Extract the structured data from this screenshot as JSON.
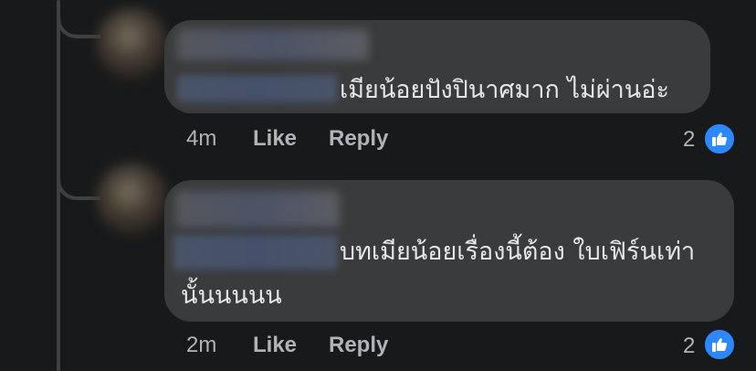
{
  "comments": [
    {
      "text_line1": "เมียน้อยปังปินาศมาก ไม่ผ่านอ่ะ",
      "time": "4m",
      "like_label": "Like",
      "reply_label": "Reply",
      "reaction_count": "2",
      "reaction_icon": "thumbs-up-icon"
    },
    {
      "text_line1": "บทเมียน้อยเรื่องนี้ต้อง ใบเฟิร์นเท่า",
      "text_line2": "นั้นนนนน",
      "time": "2m",
      "like_label": "Like",
      "reply_label": "Reply",
      "reaction_count": "2",
      "reaction_icon": "thumbs-up-icon"
    }
  ],
  "colors": {
    "background": "#18191a",
    "bubble": "#3a3b3c",
    "text": "#e4e6eb",
    "meta": "#b0b3b8",
    "like_badge": "#2d88ff"
  }
}
